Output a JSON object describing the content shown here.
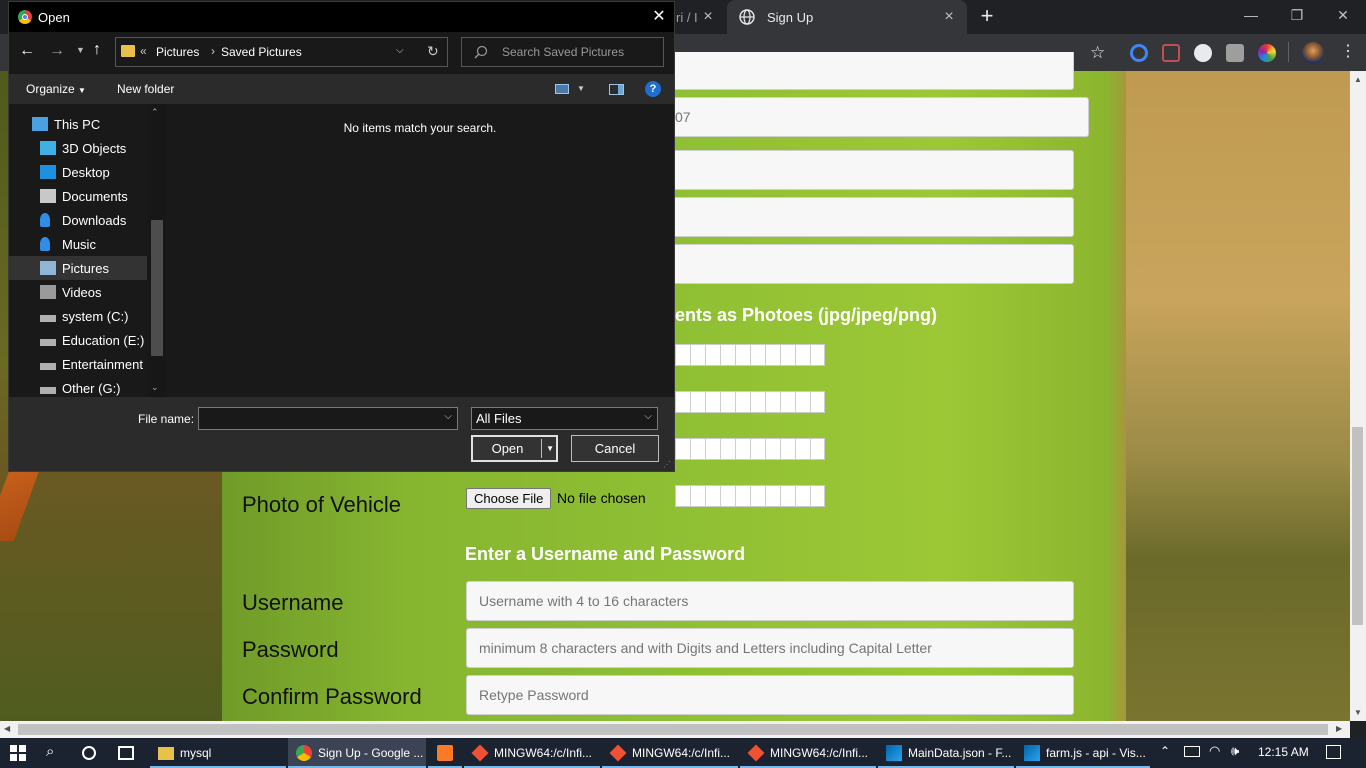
{
  "browser": {
    "tabs": [
      {
        "label": "ri / I"
      },
      {
        "label": "Sign Up"
      }
    ],
    "new_tab": "+",
    "window_controls": {
      "minimize": "—",
      "restore": "❐",
      "close": "✕"
    }
  },
  "page": {
    "partial_value": "07",
    "documents_heading": "ents as Photoes (jpg/jpeg/png)",
    "vehicle_label": "Photo of Vehicle",
    "choose_file": "Choose File",
    "no_file": "No file chosen",
    "credentials_heading": "Enter a Username and Password",
    "username_label": "Username",
    "username_placeholder": "Username with 4 to 16 characters",
    "password_label": "Password",
    "password_placeholder": "minimum 8 characters and with Digits and Letters including Capital Letter",
    "confirm_label": "Confirm Password",
    "confirm_placeholder": "Retype Password"
  },
  "dialog": {
    "title": "Open",
    "close": "✕",
    "breadcrumb": {
      "overflow": "«",
      "parent": "Pictures",
      "sep": "›",
      "current": "Saved Pictures"
    },
    "search_placeholder": "Search Saved Pictures",
    "organize": "Organize",
    "new_folder": "New folder",
    "help": "?",
    "nav_items": [
      {
        "label": "This PC",
        "icon": "pc-icon",
        "color": "#4aa0e0"
      },
      {
        "label": "3D Objects",
        "icon": "cube-icon",
        "color": "#3fb0e6"
      },
      {
        "label": "Desktop",
        "icon": "desktop-icon",
        "color": "#1e90e0"
      },
      {
        "label": "Documents",
        "icon": "document-icon",
        "color": "#c8c8c8"
      },
      {
        "label": "Downloads",
        "icon": "download-icon",
        "color": "#2f8fe6"
      },
      {
        "label": "Music",
        "icon": "music-icon",
        "color": "#2f8fe6"
      },
      {
        "label": "Pictures",
        "icon": "pictures-icon",
        "color": "#8fb7d8"
      },
      {
        "label": "Videos",
        "icon": "video-icon",
        "color": "#9a9a9a"
      },
      {
        "label": "system (C:)",
        "icon": "drive-icon",
        "color": "#b0b0b0"
      },
      {
        "label": "Education (E:)",
        "icon": "drive-icon",
        "color": "#b0b0b0"
      },
      {
        "label": "Entertainment (F",
        "icon": "drive-icon",
        "color": "#b0b0b0"
      },
      {
        "label": "Other (G:)",
        "icon": "drive-icon",
        "color": "#b0b0b0"
      }
    ],
    "empty_message": "No items match your search.",
    "file_name_label": "File name:",
    "file_name_value": "",
    "file_type": "All Files",
    "open": "Open",
    "cancel": "Cancel"
  },
  "taskbar": {
    "items": [
      {
        "label": "mysql",
        "icon": "folder-icon"
      },
      {
        "label": "Sign Up - Google ...",
        "icon": "chrome-icon"
      },
      {
        "label": "",
        "icon": "xampp-icon"
      },
      {
        "label": "MINGW64:/c/Infi...",
        "icon": "git-bash-icon"
      },
      {
        "label": "MINGW64:/c/Infi...",
        "icon": "git-bash-icon"
      },
      {
        "label": "MINGW64:/c/Infi...",
        "icon": "git-bash-icon"
      },
      {
        "label": "MainData.json - F...",
        "icon": "vscode-icon"
      },
      {
        "label": "farm.js - api - Vis...",
        "icon": "vscode-icon"
      }
    ],
    "clock": "12:15 AM"
  },
  "colors": {
    "dialog_bg": "#191919",
    "chrome_bg": "#202124",
    "accent": "#76b9ed"
  }
}
